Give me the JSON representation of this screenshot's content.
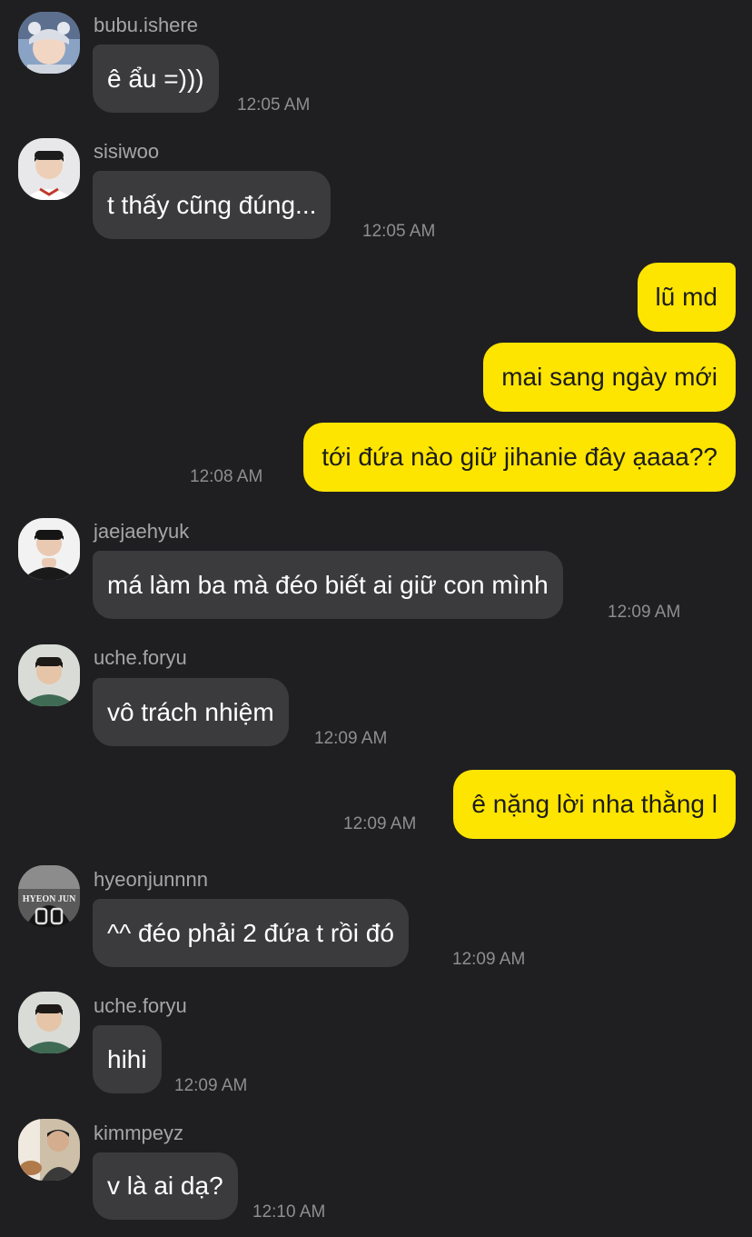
{
  "messages": [
    {
      "type": "in",
      "user": "bubu.ishere",
      "text": "ê ẩu =)))",
      "time": "12:05 AM"
    },
    {
      "type": "in",
      "user": "sisiwoo",
      "text": "t thấy cũng đúng...",
      "time": "12:05 AM"
    },
    {
      "type": "out",
      "text": "lũ md"
    },
    {
      "type": "out",
      "text": "mai sang ngày mới"
    },
    {
      "type": "out",
      "text": "tới đứa nào giữ jihanie đây ạaaa??",
      "time": "12:08 AM"
    },
    {
      "type": "in",
      "user": "jaejaehyuk",
      "text": "má làm ba mà đéo biết ai giữ con mình",
      "time": "12:09 AM"
    },
    {
      "type": "in",
      "user": "uche.foryu",
      "text": "vô trách nhiệm",
      "time": "12:09 AM"
    },
    {
      "type": "out",
      "text": "ê nặng lời nha thằng l",
      "time": "12:09 AM"
    },
    {
      "type": "in",
      "user": "hyeonjunnnn",
      "text": "^^ đéo phải 2 đứa t rồi đó",
      "time": "12:09 AM",
      "avatar_text": "HYEON JUN"
    },
    {
      "type": "in",
      "user": "uche.foryu",
      "text": "hihi",
      "time": "12:09 AM"
    },
    {
      "type": "in",
      "user": "kimmpeyz",
      "text": "v là ai dạ?",
      "time": "12:10 AM"
    }
  ],
  "colors": {
    "background": "#1f1f21",
    "incoming_bubble": "#3b3b3e",
    "outgoing_bubble": "#fee500",
    "username": "#a6a6a8",
    "timestamp": "#8e8e91"
  }
}
